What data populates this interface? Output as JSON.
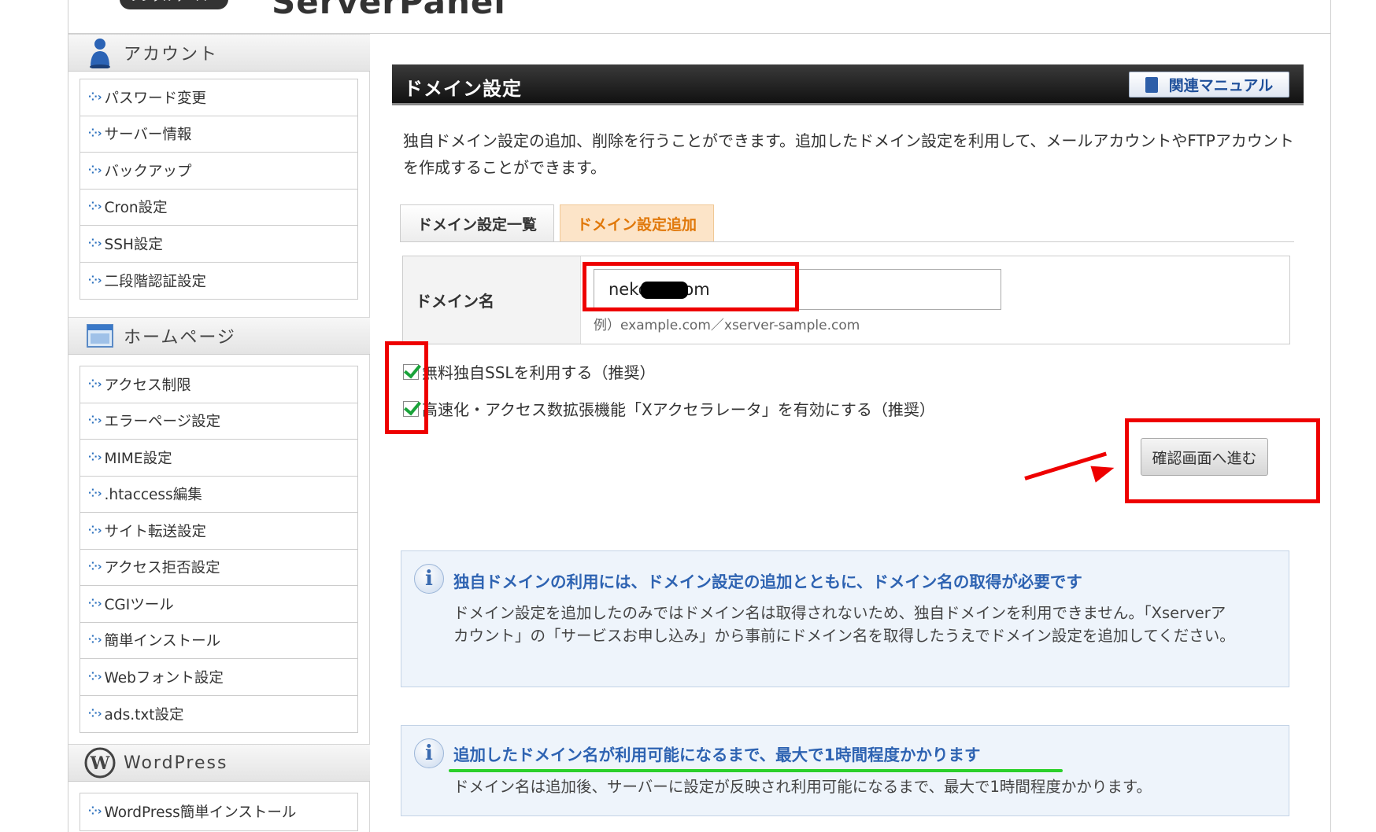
{
  "header": {
    "badge_text": "レンタルサーバー",
    "brand_text": "ServerPanel"
  },
  "sidebar": {
    "sections": [
      {
        "title": "アカウント",
        "icon": "person-icon",
        "items": [
          "パスワード変更",
          "サーバー情報",
          "バックアップ",
          "Cron設定",
          "SSH設定",
          "二段階認証設定"
        ]
      },
      {
        "title": "ホームページ",
        "icon": "homepage-window-icon",
        "items": [
          "アクセス制限",
          "エラーページ設定",
          "MIME設定",
          ".htaccess編集",
          "サイト転送設定",
          "アクセス拒否設定",
          "CGIツール",
          "簡単インストール",
          "Webフォント設定",
          "ads.txt設定"
        ]
      },
      {
        "title": "WordPress",
        "icon": "wordpress-icon",
        "items": [
          "WordPress簡単インストール"
        ]
      }
    ]
  },
  "main": {
    "title": "ドメイン設定",
    "manual_label": "関連マニュアル",
    "description": "独自ドメイン設定の追加、削除を行うことができます。追加したドメイン設定を利用して、メールアカウントやFTPアカウントを作成することができます。",
    "tabs": [
      {
        "label": "ドメイン設定一覧",
        "active": false
      },
      {
        "label": "ドメイン設定追加",
        "active": true
      }
    ],
    "form": {
      "label": "ドメイン名",
      "value": "neko    .com",
      "example": "例）example.com／xserver-sample.com"
    },
    "options": [
      {
        "label": "無料独自SSLを利用する（推奨）",
        "checked": true
      },
      {
        "label": "高速化・アクセス数拡張機能「Xアクセラレータ」を有効にする（推奨）",
        "checked": true
      }
    ],
    "confirm_label": "確認画面へ進む",
    "notices": [
      {
        "title": "独自ドメインの利用には、ドメイン設定の追加とともに、ドメイン名の取得が必要です",
        "body": "ドメイン設定を追加したのみではドメイン名は取得されないため、独自ドメインを利用できません。「Xserverアカウント」の「サービスお申し込み」から事前にドメイン名を取得したうえでドメイン設定を追加してください。"
      },
      {
        "title": "追加したドメイン名が利用可能になるまで、最大で1時間程度かかります",
        "body": "ドメイン名は追加後、サーバーに設定が反映され利用可能になるまで、最大で1時間程度かかります。"
      }
    ]
  },
  "colors": {
    "annotation_red": "#ee0000",
    "annotation_green": "#2bd02b",
    "active_tab_text": "#e0780a",
    "notice_title": "#2e63b2"
  }
}
